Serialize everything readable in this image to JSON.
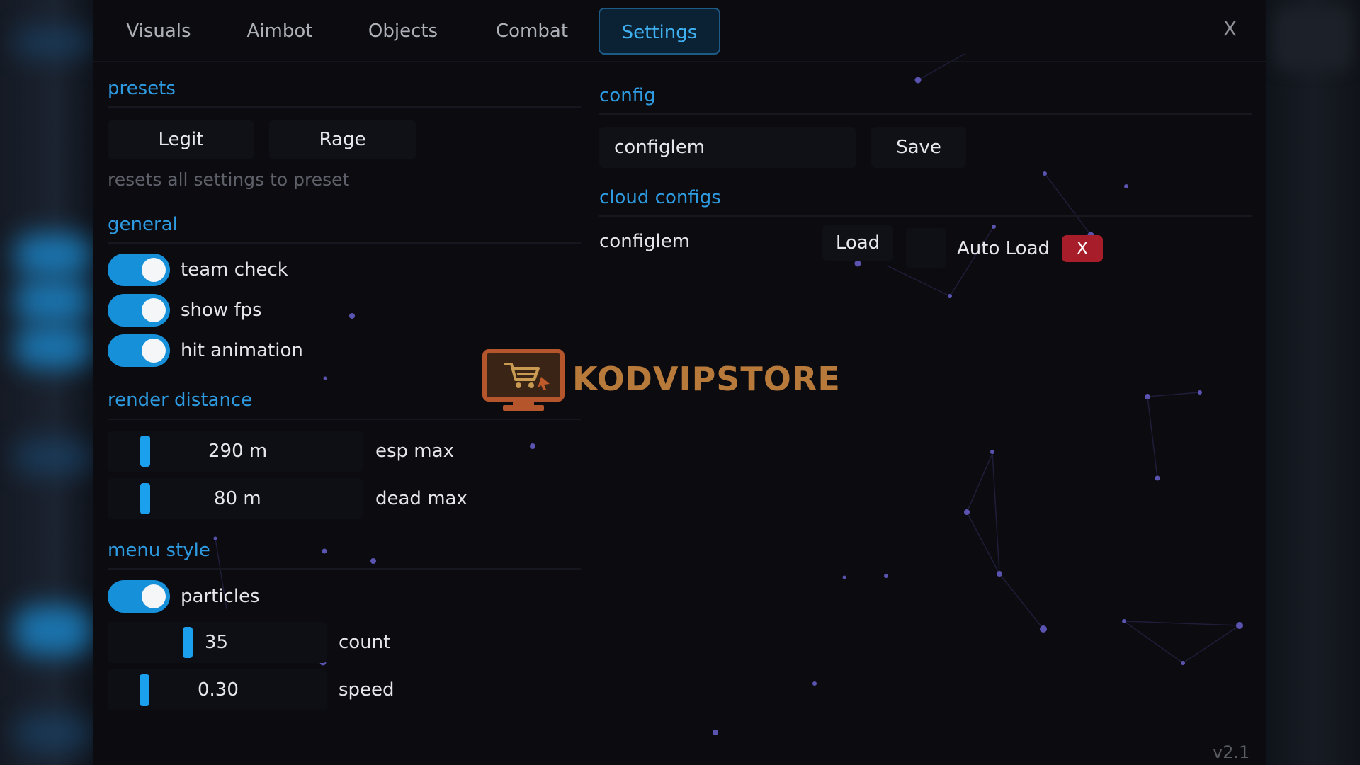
{
  "tabs": [
    {
      "label": "Visuals",
      "active": false
    },
    {
      "label": "Aimbot",
      "active": false
    },
    {
      "label": "Objects",
      "active": false
    },
    {
      "label": "Combat",
      "active": false
    },
    {
      "label": "Settings",
      "active": true
    }
  ],
  "close_label": "X",
  "presets": {
    "title": "presets",
    "buttons": [
      "Legit",
      "Rage"
    ],
    "hint": "resets all settings to preset"
  },
  "general": {
    "title": "general",
    "toggles": [
      {
        "label": "team check",
        "on": true
      },
      {
        "label": "show fps",
        "on": true
      },
      {
        "label": "hit animation",
        "on": true
      }
    ]
  },
  "render_distance": {
    "title": "render distance",
    "sliders": [
      {
        "value": "290 m",
        "label": "esp max"
      },
      {
        "value": "80 m",
        "label": "dead max"
      }
    ]
  },
  "menu_style": {
    "title": "menu style",
    "toggle": {
      "label": "particles",
      "on": true
    },
    "sliders": [
      {
        "value": "35",
        "label": "count"
      },
      {
        "value": "0.30",
        "label": "speed"
      }
    ]
  },
  "config": {
    "title": "config",
    "name_value": "configlem",
    "save_label": "Save"
  },
  "cloud_configs": {
    "title": "cloud configs",
    "entry_name": "configlem",
    "load_label": "Load",
    "auto_load_label": "Auto Load",
    "delete_label": "X"
  },
  "version": "v2.1",
  "watermark": {
    "brand": "KODVIPSTORE"
  },
  "colors": {
    "accent": "#1790da",
    "section": "#2e9ae0",
    "danger": "#a71e2a",
    "brand": "#b77a3b"
  }
}
